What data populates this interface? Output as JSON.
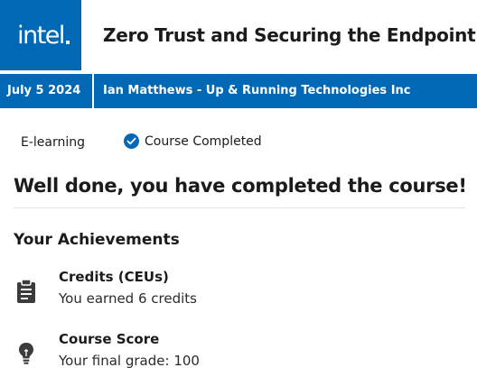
{
  "header": {
    "logo_text": "intel",
    "title": "Zero Trust and Securing the Endpoint",
    "brand_color": "#0068b5"
  },
  "banner": {
    "date": "July 5 2024",
    "org": "Ian Matthews - Up & Running Technologies Inc"
  },
  "meta": {
    "type": "E-learning",
    "status": "Course Completed",
    "status_icon": "check-circle-icon"
  },
  "completion_message": "Well done, you have completed the course!",
  "achievements": {
    "heading": "Your Achievements",
    "items": [
      {
        "icon": "clipboard-icon",
        "title": "Credits (CEUs)",
        "description": "You earned 6 credits"
      },
      {
        "icon": "lightbulb-icon",
        "title": "Course Score",
        "description": "Your final grade: 100"
      }
    ]
  }
}
